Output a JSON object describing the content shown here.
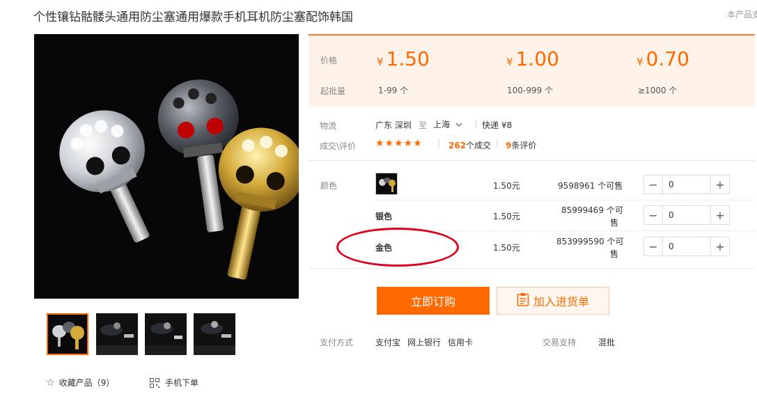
{
  "product": {
    "title": "个性镶钻骷髅头通用防尘塞通用爆款手机耳机防尘塞配饰韩国",
    "corner_text": "本产品支"
  },
  "price_box": {
    "price_label": "价格",
    "moq_label": "起批量",
    "currency": "¥",
    "tiers": [
      {
        "price": "1.50",
        "range": "1-99 个"
      },
      {
        "price": "1.00",
        "range": "100-999 个"
      },
      {
        "price": "0.70",
        "range": "≥1000 个"
      }
    ]
  },
  "logistics": {
    "label": "物流",
    "from": "广东 深圳",
    "to_word": "至",
    "to": "上海",
    "express": "快递 ¥8"
  },
  "deals": {
    "label": "成交\\评价",
    "stars": "★★★★★",
    "sep": "|",
    "deals_count": "262",
    "deals_unit": "个成交",
    "reviews_count": "9",
    "reviews_unit": "条评价"
  },
  "color": {
    "label": "颜色",
    "options": [
      {
        "name": "",
        "price": "1.50元",
        "stock": "9598961 个可售",
        "qty": "0"
      },
      {
        "name": "银色",
        "price": "1.50元",
        "stock_line1": "85999469 个可",
        "stock_line2": "售",
        "qty": "0"
      },
      {
        "name": "金色",
        "price": "1.50元",
        "stock_line1": "853999590 个可",
        "stock_line2": "售",
        "qty": "0"
      }
    ]
  },
  "actions": {
    "buy_label": "立即订购",
    "cart_label": "加入进货单"
  },
  "payment": {
    "label": "支付方式",
    "methods": [
      "支付宝",
      "网上银行",
      "信用卡"
    ],
    "support_label": "交易支持",
    "support_value": "混批"
  },
  "footer": {
    "favorite_label": "收藏产品（9）",
    "mobile_label": "手机下单"
  },
  "colors": {
    "accent": "#ff6a00",
    "annotation": "#e0001b",
    "price_bg": "#fff2e8"
  }
}
